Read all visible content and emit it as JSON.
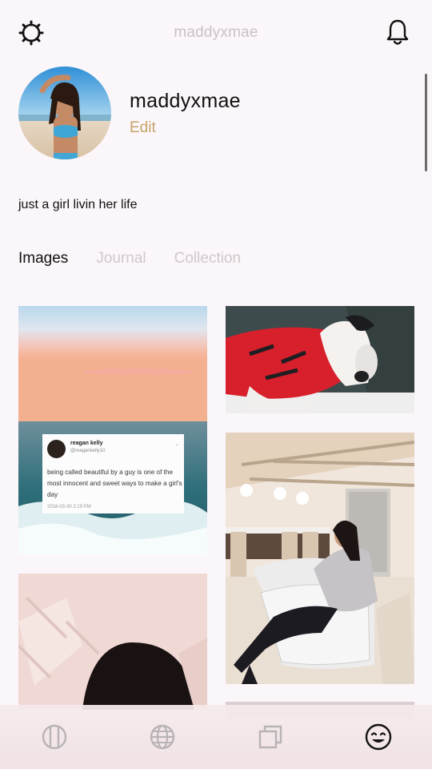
{
  "header": {
    "title": "maddyxmae"
  },
  "profile": {
    "username": "maddyxmae",
    "edit_label": "Edit",
    "bio": "just a girl livin her life"
  },
  "tabs": [
    {
      "label": "Images",
      "active": true
    },
    {
      "label": "Journal",
      "active": false
    },
    {
      "label": "Collection",
      "active": false
    }
  ],
  "tweet": {
    "name": "reagan kelly",
    "handle": "@reagankelly10",
    "text": "being called beautiful by a guy is one of the most innocent and sweet ways to make a girl's day",
    "time": "2018-03-30  2:19 PM"
  },
  "bottom_nav": [
    {
      "icon": "circle-stripes-icon",
      "active": false
    },
    {
      "icon": "globe-icon",
      "active": false
    },
    {
      "icon": "stack-icon",
      "active": false
    },
    {
      "icon": "smiley-icon",
      "active": true
    }
  ],
  "colors": {
    "background": "#fbf6f9",
    "accent": "#c7a36a",
    "inactive": "#d0c8cc",
    "text": "#111111"
  }
}
